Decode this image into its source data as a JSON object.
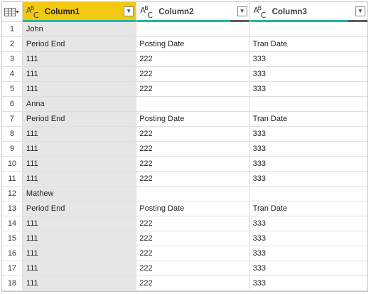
{
  "header": {
    "columns": [
      {
        "name": "Column1",
        "type_icon": "ABC-text-type-icon",
        "selected": true,
        "quality": {
          "valid": 1.0,
          "empty": 0.0
        }
      },
      {
        "name": "Column2",
        "type_icon": "ABC-text-type-icon",
        "selected": false,
        "quality": {
          "valid": 0.83,
          "empty": 0.17
        }
      },
      {
        "name": "Column3",
        "type_icon": "ABC-text-type-icon",
        "selected": false,
        "quality": {
          "valid": 0.83,
          "empty": 0.17
        }
      }
    ],
    "table_menu_icon": "table-icon",
    "dropdown_icon": "chevron-down-icon"
  },
  "rows": [
    {
      "index": "1",
      "c1": "John",
      "c2": "",
      "c3": ""
    },
    {
      "index": "2",
      "c1": "Period End",
      "c2": "Posting Date",
      "c3": "Tran Date"
    },
    {
      "index": "3",
      "c1": "111",
      "c2": "222",
      "c3": "333"
    },
    {
      "index": "4",
      "c1": "111",
      "c2": "222",
      "c3": "333"
    },
    {
      "index": "5",
      "c1": "111",
      "c2": "222",
      "c3": "333"
    },
    {
      "index": "6",
      "c1": "Anna",
      "c2": "",
      "c3": ""
    },
    {
      "index": "7",
      "c1": "Period End",
      "c2": "Posting Date",
      "c3": "Tran Date"
    },
    {
      "index": "8",
      "c1": "111",
      "c2": "222",
      "c3": "333"
    },
    {
      "index": "9",
      "c1": "111",
      "c2": "222",
      "c3": "333"
    },
    {
      "index": "10",
      "c1": "111",
      "c2": "222",
      "c3": "333"
    },
    {
      "index": "11",
      "c1": "111",
      "c2": "222",
      "c3": "333"
    },
    {
      "index": "12",
      "c1": "Mathew",
      "c2": "",
      "c3": ""
    },
    {
      "index": "13",
      "c1": "Period End",
      "c2": "Posting Date",
      "c3": "Tran Date"
    },
    {
      "index": "14",
      "c1": "111",
      "c2": "222",
      "c3": "333"
    },
    {
      "index": "15",
      "c1": "111",
      "c2": "222",
      "c3": "333"
    },
    {
      "index": "16",
      "c1": "111",
      "c2": "222",
      "c3": "333"
    },
    {
      "index": "17",
      "c1": "111",
      "c2": "222",
      "c3": "333"
    },
    {
      "index": "18",
      "c1": "111",
      "c2": "222",
      "c3": "333"
    }
  ],
  "colors": {
    "selected_header": "#f2c811",
    "selected_column_bg": "#e6e6e6",
    "quality_valid": "#1fb7a4",
    "quality_empty": "#605e5c"
  }
}
